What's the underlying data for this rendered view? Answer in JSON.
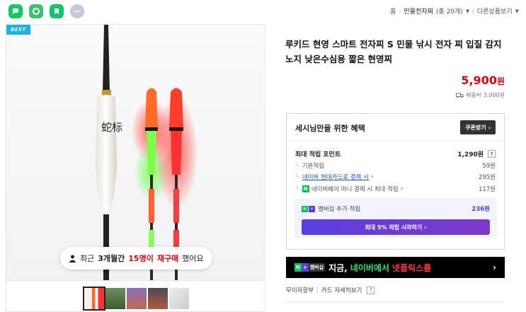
{
  "share_icons": [
    {
      "name": "talk-share-icon",
      "color": "#14c964"
    },
    {
      "name": "band-share-icon",
      "color": "#3dc26c"
    },
    {
      "name": "blog-share-icon",
      "color": "#15c36b"
    },
    {
      "name": "more-share-icon",
      "color": "#c5c9d6"
    }
  ],
  "breadcrumb": {
    "home": "홈",
    "current": "민물전자찌",
    "count": "(총 20개)",
    "other": "다른상품보기"
  },
  "image": {
    "badge": "BEST",
    "logo_text": "蛇标",
    "notice": {
      "prefix": "최근",
      "period": "3개월간",
      "count": "15명이",
      "highlight": "재구매",
      "suffix": "했어요"
    }
  },
  "product": {
    "title": "루키드 현영 스마트 전자찌 S 민물 낚시 전자 찌 입질 감지 노지 낮은수심용 짧은 현영찌",
    "price": "5,900",
    "price_unit": "원",
    "shipping": "배송비 3,000원"
  },
  "benefit": {
    "title": "세시님만을 위한 혜택",
    "coupon_button": "쿠폰받기",
    "max_points_label": "최대 적립 포인트",
    "max_points": "1,290원",
    "rows": [
      {
        "label": "기본적립",
        "value": "59원",
        "link": false
      },
      {
        "label": "네이버 현대카드로 결제 시",
        "value": "295원",
        "link": true
      },
      {
        "label": "네이버페이 머니 결제 시 최대 적립",
        "value": "117원",
        "link": false
      }
    ],
    "membership_label": "멤버십 추가 적립",
    "membership_value": "236원",
    "membership_button": "최대 5% 적립 시작하기"
  },
  "banner": {
    "badge": "멤버십",
    "text_white": "지금,",
    "text_green": "네이버에서",
    "text_red": "넷플릭스를"
  },
  "installment": {
    "label": "무이자할부",
    "card_details": "카드 자세히보기"
  },
  "colors": {
    "price": "#e60012",
    "accent_purple": "#5a3fe0",
    "link": "#1a5ac8"
  }
}
